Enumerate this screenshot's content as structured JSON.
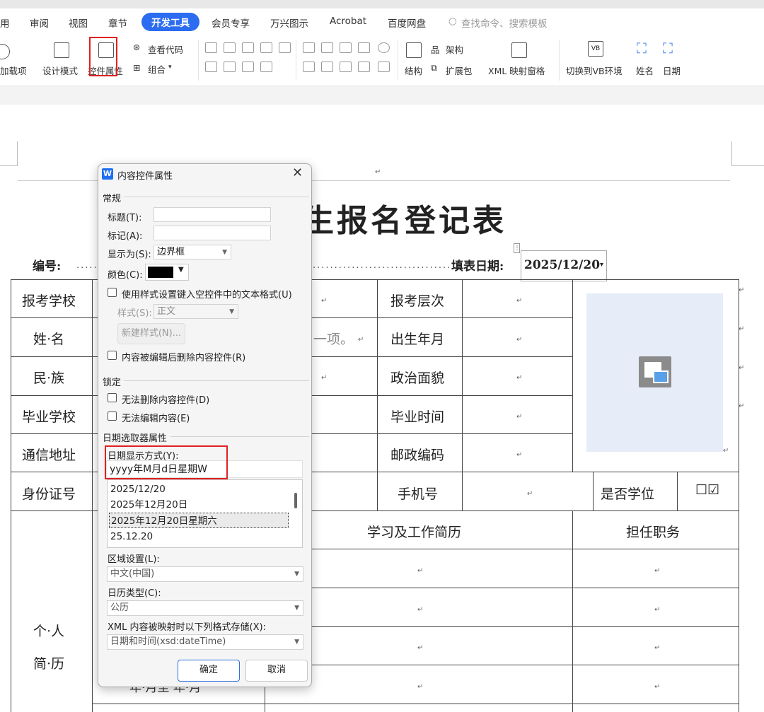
{
  "menu": {
    "items": [
      "用",
      "审阅",
      "视图",
      "章节",
      "开发工具",
      "会员专享",
      "万兴图示",
      "Acrobat",
      "百度网盘"
    ],
    "search": "查找命令、搜索模板"
  },
  "ribbon": {
    "addins": "加载项",
    "design_mode": "设计模式",
    "control_props": "控件属性",
    "view_code": "查看代码",
    "group": "组合",
    "structure": "结构",
    "schema": "架构",
    "expansion": "扩展包",
    "xml_pane": "XML 映射窗格",
    "vb": "切换到VB环境",
    "name": "姓名",
    "date": "日期"
  },
  "doc": {
    "title_visible": "生报名登记表",
    "number_label": "编号:",
    "date_label": "填表日期:",
    "date_value": "2025/12/20",
    "row_labels": [
      "报考学校",
      "姓·名",
      "民·族",
      "毕业学校",
      "通信地址",
      "身份证号"
    ],
    "right_labels": [
      "报考层次",
      "出生年月",
      "政治面貌",
      "毕业时间",
      "邮政编码"
    ],
    "phone": "手机号",
    "degree": "是否学位",
    "checkbox_glyphs": "☐☑",
    "placeholder_fragment": "一项。",
    "resume_header": "学习及工作简历",
    "position_header": "担任职务",
    "personal": "个·人",
    "resume": "简·历",
    "footer_fragment": "年·月至 年·月"
  },
  "dialog": {
    "title": "内容控件属性",
    "close": "✕",
    "sec_general": "常规",
    "title_label": "标题(T):",
    "tag_label": "标记(A):",
    "show_as_label": "显示为(S):",
    "show_as_value": "边界框",
    "color_label": "颜色(C):",
    "color_value": "#000000",
    "use_style": "使用样式设置键入空控件中的文本格式(U)",
    "style_label": "样式(S):",
    "style_value": "正文",
    "new_style": "新建样式(N)...",
    "remove_on_edit": "内容被编辑后删除内容控件(R)",
    "sec_lock": "锁定",
    "cannot_delete": "无法删除内容控件(D)",
    "cannot_edit": "无法编辑内容(E)",
    "sec_date": "日期选取器属性",
    "date_format_label": "日期显示方式(Y):",
    "date_format_value": "yyyy年M月d日星期W",
    "formats": [
      "2025/12/20",
      "2025年12月20日",
      "2025年12月20日星期六",
      "25.12.20"
    ],
    "locale_label": "区域设置(L):",
    "locale_value": "中文(中国)",
    "calendar_label": "日历类型(C):",
    "calendar_value": "公历",
    "xml_label": "XML 内容被映射时以下列格式存储(X):",
    "xml_value": "日期和时间(xsd:dateTime)",
    "ok": "确定",
    "cancel": "取消"
  },
  "colors": {
    "accent": "#2b6cf0",
    "highlight": "#e02020",
    "photo_bg": "#e6edf8"
  }
}
